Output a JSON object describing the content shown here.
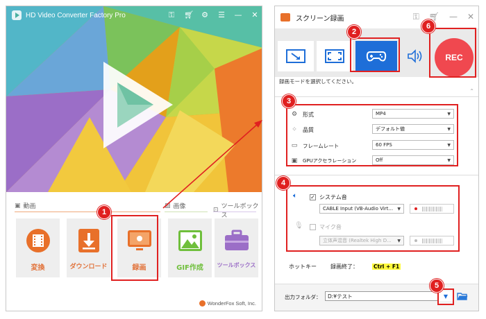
{
  "left_window": {
    "title": "HD Video Converter Factory Pro",
    "sections": {
      "video": "動画",
      "image": "画像",
      "toolbox": "ツールボックス"
    },
    "tools": [
      {
        "label": "変換",
        "icon": "film-icon"
      },
      {
        "label": "ダウンロード",
        "icon": "download-icon"
      },
      {
        "label": "録画",
        "icon": "screen-record-icon"
      },
      {
        "label": "GIF作成",
        "icon": "image-icon"
      },
      {
        "label": "ツールボックス",
        "icon": "toolbox-icon"
      }
    ],
    "footer": "WonderFox Soft, Inc."
  },
  "right_window": {
    "title": "スクリーン録画",
    "rec_label": "REC",
    "mode_hint": "録画モードを選択してください。",
    "settings": [
      {
        "label": "形式",
        "value": "MP4",
        "icon": "gear-icon"
      },
      {
        "label": "品質",
        "value": "デフォルト値",
        "icon": "quality-icon"
      },
      {
        "label": "フレームレート",
        "value": "60 FPS",
        "icon": "film-strip-icon"
      },
      {
        "label": "GPUアクセラレーション",
        "value": "Off",
        "icon": "gpu-icon"
      }
    ],
    "audio": {
      "system_label": "システム音",
      "system_device": "CABLE Input (VB-Audio Virt...",
      "mic_label": "マイク音",
      "mic_device": "立体声混音 (Realtek High D..."
    },
    "hotkey": {
      "label": "ホットキー",
      "stop_label": "録画終了：",
      "key": "Ctrl + F1"
    },
    "output": {
      "label": "出力フォルダ：",
      "path": "D:¥テスト"
    }
  },
  "badges": [
    "1",
    "2",
    "3",
    "4",
    "5",
    "6"
  ],
  "colors": {
    "accent_orange": "#e8702a",
    "active_blue": "#1e6ed8",
    "rec_red": "#f0484f",
    "annotation_red": "#e02020"
  }
}
